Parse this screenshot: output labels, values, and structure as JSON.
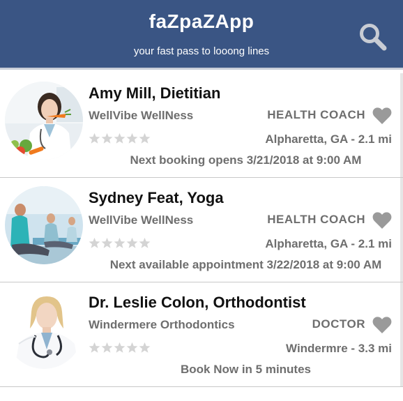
{
  "header": {
    "title": "faZpaZApp",
    "tagline": "your fast pass to looong lines",
    "search_icon": "search-icon",
    "background": "#3a5584"
  },
  "providers": [
    {
      "name": "Amy Mill, Dietitian",
      "organization": "WellVibe WellNess",
      "category": "HEALTH COACH",
      "location": "Alpharetta, GA - 2.1 mi",
      "rating": 0,
      "availability": "Next booking opens 3/21/2018 at 9:00 AM",
      "favorite_icon": "heart-icon"
    },
    {
      "name": "Sydney Feat, Yoga",
      "organization": "WellVibe WellNess",
      "category": "HEALTH COACH",
      "location": "Alpharetta, GA - 2.1 mi",
      "rating": 0,
      "availability": "Next available appointment 3/22/2018 at 9:00 AM",
      "favorite_icon": "heart-icon"
    },
    {
      "name": "Dr. Leslie Colon, Orthodontist",
      "organization": "Windermere Orthodontics",
      "category": "DOCTOR",
      "location": "Windermre - 3.3 mi",
      "rating": 0,
      "availability": "Book Now in 5 minutes",
      "favorite_icon": "heart-icon"
    }
  ],
  "colors": {
    "header": "#3a5584",
    "muted_text": "#6e6e6e",
    "star_empty": "#d4d4d4",
    "heart": "#9a9a9a"
  }
}
